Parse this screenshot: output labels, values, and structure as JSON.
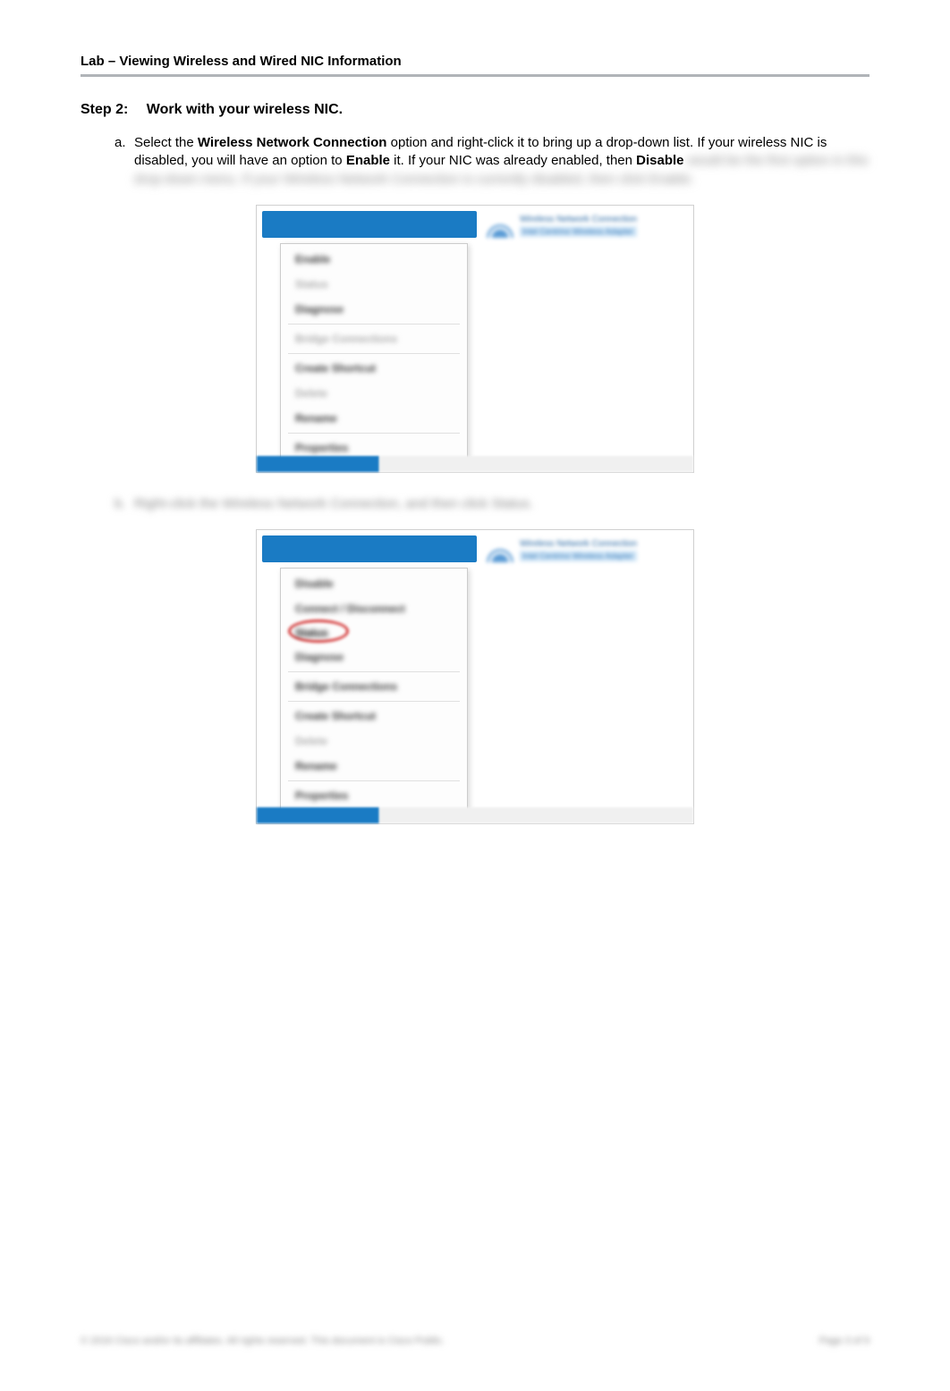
{
  "header": {
    "title": "Lab – Viewing Wireless and Wired NIC Information"
  },
  "step": {
    "number": "Step 2:",
    "text": "Work with your wireless NIC."
  },
  "items": {
    "a": {
      "letter": "a.",
      "pre1": "Select the ",
      "bold1": "Wireless Network Connection",
      "mid1": " option and right-click it to bring up a drop-down list. If your wireless NIC is disabled, you will have an option to ",
      "bold2": "Enable",
      "mid2": " it. If your NIC was already enabled, then ",
      "bold3": "Disable",
      "blurred_tail": " would be the first option in this drop-down menu. If your Wireless Network Connection is currently disabled, then click Enable."
    },
    "b": {
      "letter": "b.",
      "blurred": "Right-click the Wireless Network Connection, and then click Status."
    }
  },
  "screenshot1": {
    "right_title": "Wireless Network Connection",
    "right_sub": "Intel Centrino Wireless Adapter",
    "menu": [
      "Enable",
      "Status",
      "Diagnose",
      "Bridge Connections",
      "Create Shortcut",
      "Delete",
      "Rename",
      "Properties"
    ]
  },
  "screenshot2": {
    "right_title": "Wireless Network Connection",
    "right_sub": "Intel Centrino Wireless Adapter",
    "menu": [
      "Disable",
      "Connect / Disconnect",
      "Status",
      "Diagnose",
      "Bridge Connections",
      "Create Shortcut",
      "Delete",
      "Rename",
      "Properties"
    ]
  },
  "footer": {
    "left": "© 2016 Cisco and/or its affiliates. All rights reserved. This document is Cisco Public.",
    "right": "Page 3 of 9"
  }
}
